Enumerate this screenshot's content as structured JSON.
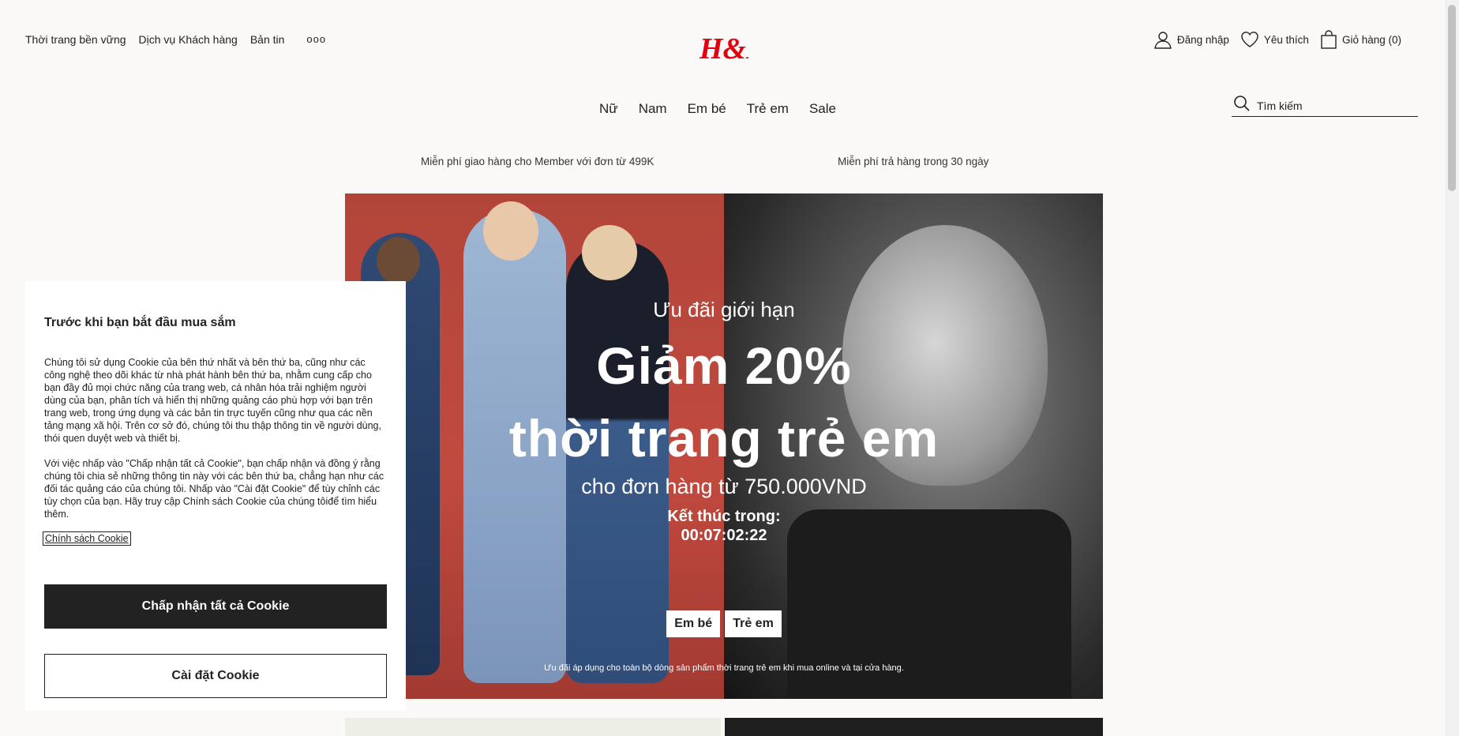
{
  "header": {
    "top_links": [
      "Thời trang bền vững",
      "Dịch vụ Khách hàng",
      "Bản tin"
    ],
    "more_label": "ooo",
    "logo_text": "H&M",
    "login_label": "Đăng nhập",
    "favorites_label": "Yêu thích",
    "cart_label": "Giỏ hàng (0)"
  },
  "nav": {
    "items": [
      "Nữ",
      "Nam",
      "Em bé",
      "Trẻ em",
      "Sale"
    ]
  },
  "search": {
    "placeholder": "Tìm kiếm"
  },
  "promos": {
    "left": "Miễn phí giao hàng cho Member với đơn từ 499K",
    "right": "Miễn phí trả hàng trong 30 ngày"
  },
  "hero": {
    "kicker": "Ưu đãi giới hạn",
    "headline_1": "Giảm 20%",
    "headline_2": "thời trang trẻ em",
    "subline": "cho đơn hàng từ 750.000VND",
    "ends_label": "Kết thúc trong:",
    "countdown": "00:07:02:22",
    "buttons": [
      "Em bé",
      "Trẻ em"
    ],
    "note": "Ưu đãi áp dụng cho toàn bộ dòng sản phẩm thời trang trẻ em khi mua online và tại cửa hàng."
  },
  "cookie": {
    "title": "Trước khi bạn bắt đầu mua sắm",
    "paragraph_1": "Chúng tôi sử dụng Cookie của bên thứ nhất và bên thứ ba, cũng như các công nghệ theo dõi khác từ nhà phát hành bên thứ ba, nhằm cung cấp cho bạn đầy đủ mọi chức năng của trang web, cá nhân hóa trải nghiệm người dùng của bạn, phân tích và hiển thị những quảng cáo phù hợp với bạn trên trang web, trong ứng dụng và các bản tin trực tuyến cũng như qua các nền tảng mạng xã hội. Trên cơ sở đó, chúng tôi thu thập thông tin về người dùng, thói quen duyệt web và thiết bị.",
    "paragraph_2": "Với việc nhấp vào \"Chấp nhận tất cả Cookie\", bạn chấp nhận và đồng ý rằng chúng tôi chia sẻ những thông tin này với các bên thứ ba, chẳng hạn như các đối tác quảng cáo của chúng tôi. Nhấp vào \"Cài đặt Cookie\" để tùy chỉnh các tùy chọn của bạn. Hãy truy cập Chính sách Cookie của chúng tôiđể tìm hiểu thêm.",
    "policy_link": "Chính sách Cookie",
    "accept_button": "Chấp nhận tất cả Cookie",
    "settings_button": "Cài đặt Cookie"
  },
  "colors": {
    "brand_red": "#e50010",
    "dark": "#222222",
    "background": "#faf9f8"
  }
}
